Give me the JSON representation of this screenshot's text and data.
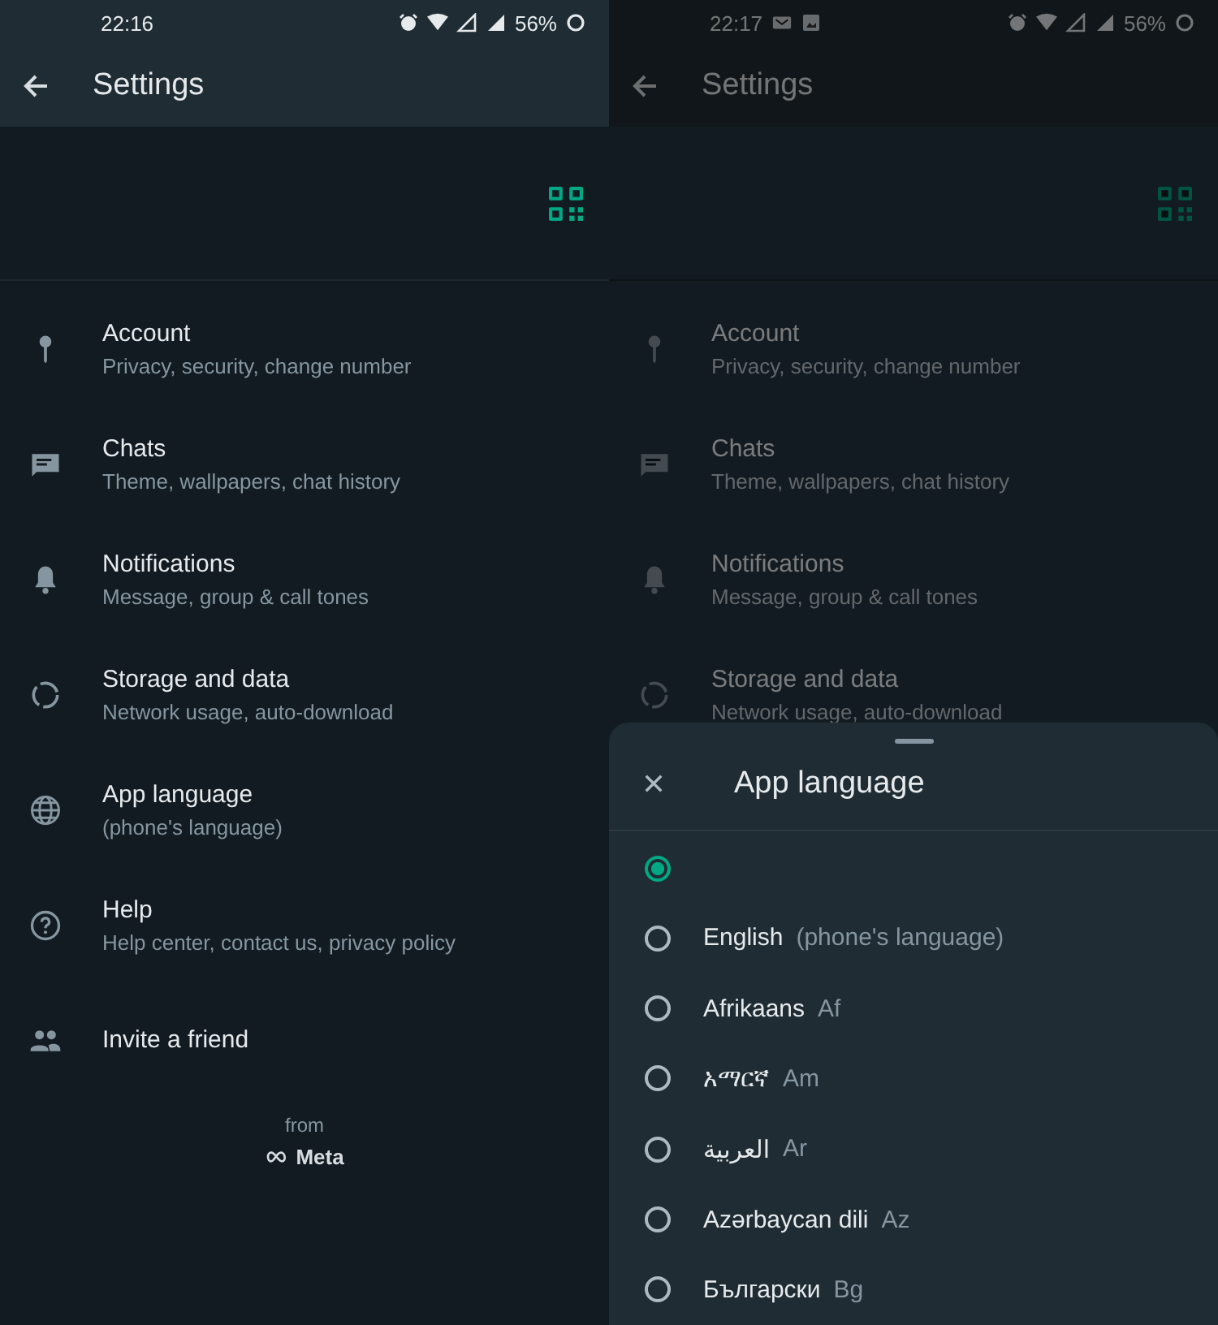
{
  "screens": [
    {
      "dimmed": false,
      "status_bar": {
        "time": "22:16",
        "notifications": false,
        "battery": "56%"
      },
      "header": {
        "title": "Settings"
      },
      "items": [
        {
          "kind": "account",
          "title": "Account",
          "subtitle": "Privacy, security, change number"
        },
        {
          "kind": "chats",
          "title": "Chats",
          "subtitle": "Theme, wallpapers, chat history"
        },
        {
          "kind": "notifications",
          "title": "Notifications",
          "subtitle": "Message, group & call tones"
        },
        {
          "kind": "storage",
          "title": "Storage and data",
          "subtitle": "Network usage, auto-download"
        },
        {
          "kind": "language",
          "title": "App language",
          "subtitle": "(phone's language)"
        },
        {
          "kind": "help",
          "title": "Help",
          "subtitle": "Help center, contact us, privacy policy"
        },
        {
          "kind": "invite",
          "title": "Invite a friend"
        }
      ],
      "footer": {
        "from": "from",
        "brand": "Meta"
      }
    },
    {
      "dimmed": true,
      "status_bar": {
        "time": "22:17",
        "notifications": true,
        "battery": "56%"
      },
      "header": {
        "title": "Settings"
      },
      "items": [
        {
          "kind": "account",
          "title": "Account",
          "subtitle": "Privacy, security, change number"
        },
        {
          "kind": "chats",
          "title": "Chats",
          "subtitle": "Theme, wallpapers, chat history"
        },
        {
          "kind": "notifications",
          "title": "Notifications",
          "subtitle": "Message, group & call tones"
        },
        {
          "kind": "storage",
          "title": "Storage and data",
          "subtitle": "Network usage, auto-download"
        }
      ],
      "sheet": {
        "title": "App language",
        "options": [
          {
            "selected": true
          },
          {
            "name": "English",
            "code": "(phone's language)",
            "selected": false
          },
          {
            "name": "Afrikaans",
            "code": "Af",
            "selected": false
          },
          {
            "name": "አማርኛ",
            "code": "Am",
            "selected": false
          },
          {
            "name": "العربية",
            "code": "Ar",
            "selected": false
          },
          {
            "name": "Azərbaycan dili",
            "code": "Az",
            "selected": false
          },
          {
            "name": "Български",
            "code": "Bg",
            "selected": false
          }
        ]
      }
    }
  ]
}
